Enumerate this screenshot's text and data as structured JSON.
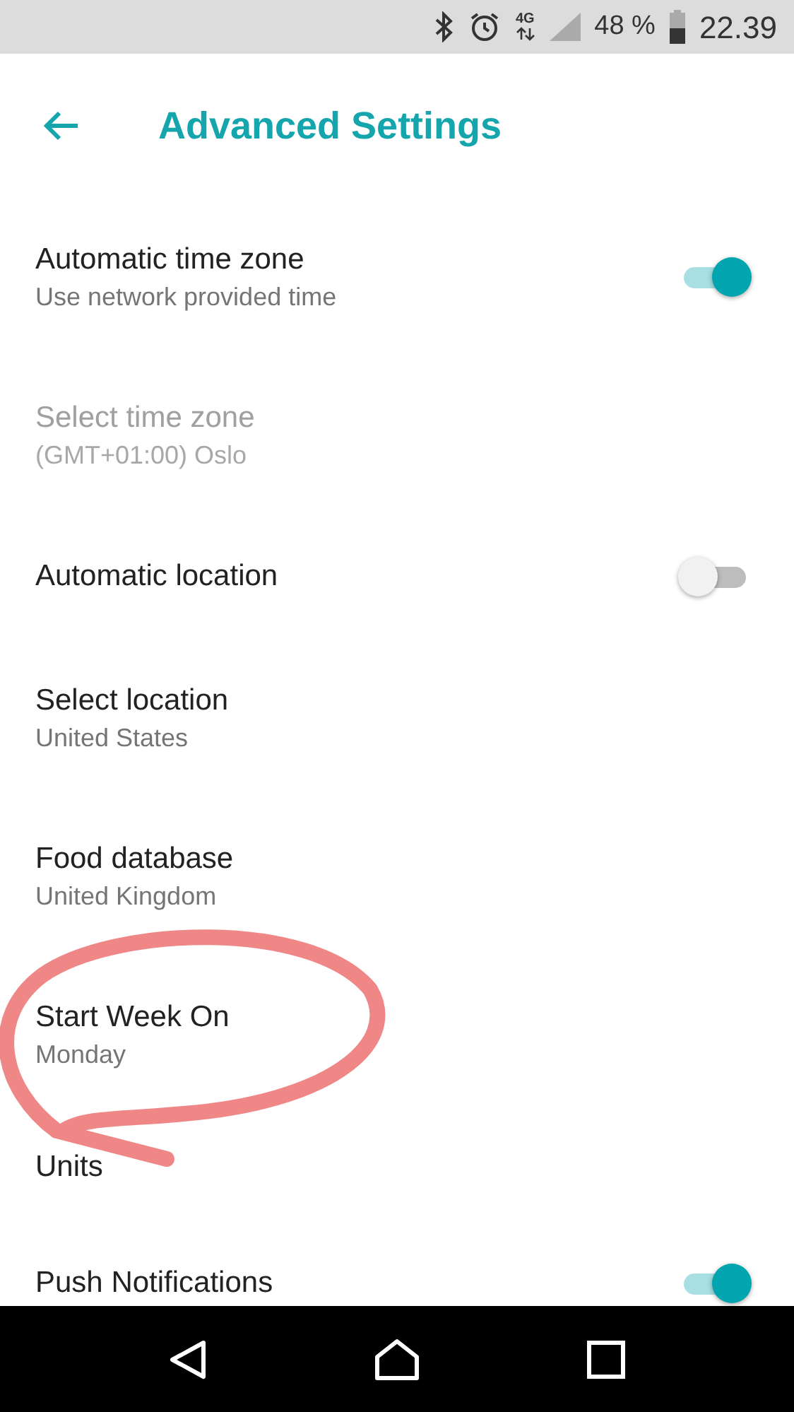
{
  "status_bar": {
    "network": "4G",
    "battery": "48 %",
    "time": "22.39"
  },
  "header": {
    "title": "Advanced Settings"
  },
  "settings": [
    {
      "kind": "toggle",
      "title": "Automatic time zone",
      "subtitle": "Use network provided time",
      "on": true,
      "disabled": false
    },
    {
      "kind": "item",
      "title": "Select time zone",
      "subtitle": "(GMT+01:00) Oslo",
      "disabled": true
    },
    {
      "kind": "toggle",
      "title": "Automatic location",
      "on": false,
      "disabled": false
    },
    {
      "kind": "item",
      "title": "Select location",
      "subtitle": "United States",
      "disabled": false
    },
    {
      "kind": "item",
      "title": "Food database",
      "subtitle": "United Kingdom",
      "disabled": false
    },
    {
      "kind": "item",
      "title": "Start Week On",
      "subtitle": "Monday",
      "disabled": false
    },
    {
      "kind": "item",
      "title": "Units",
      "disabled": false
    },
    {
      "kind": "toggle",
      "title": "Push Notifications",
      "on": true,
      "disabled": false
    }
  ]
}
